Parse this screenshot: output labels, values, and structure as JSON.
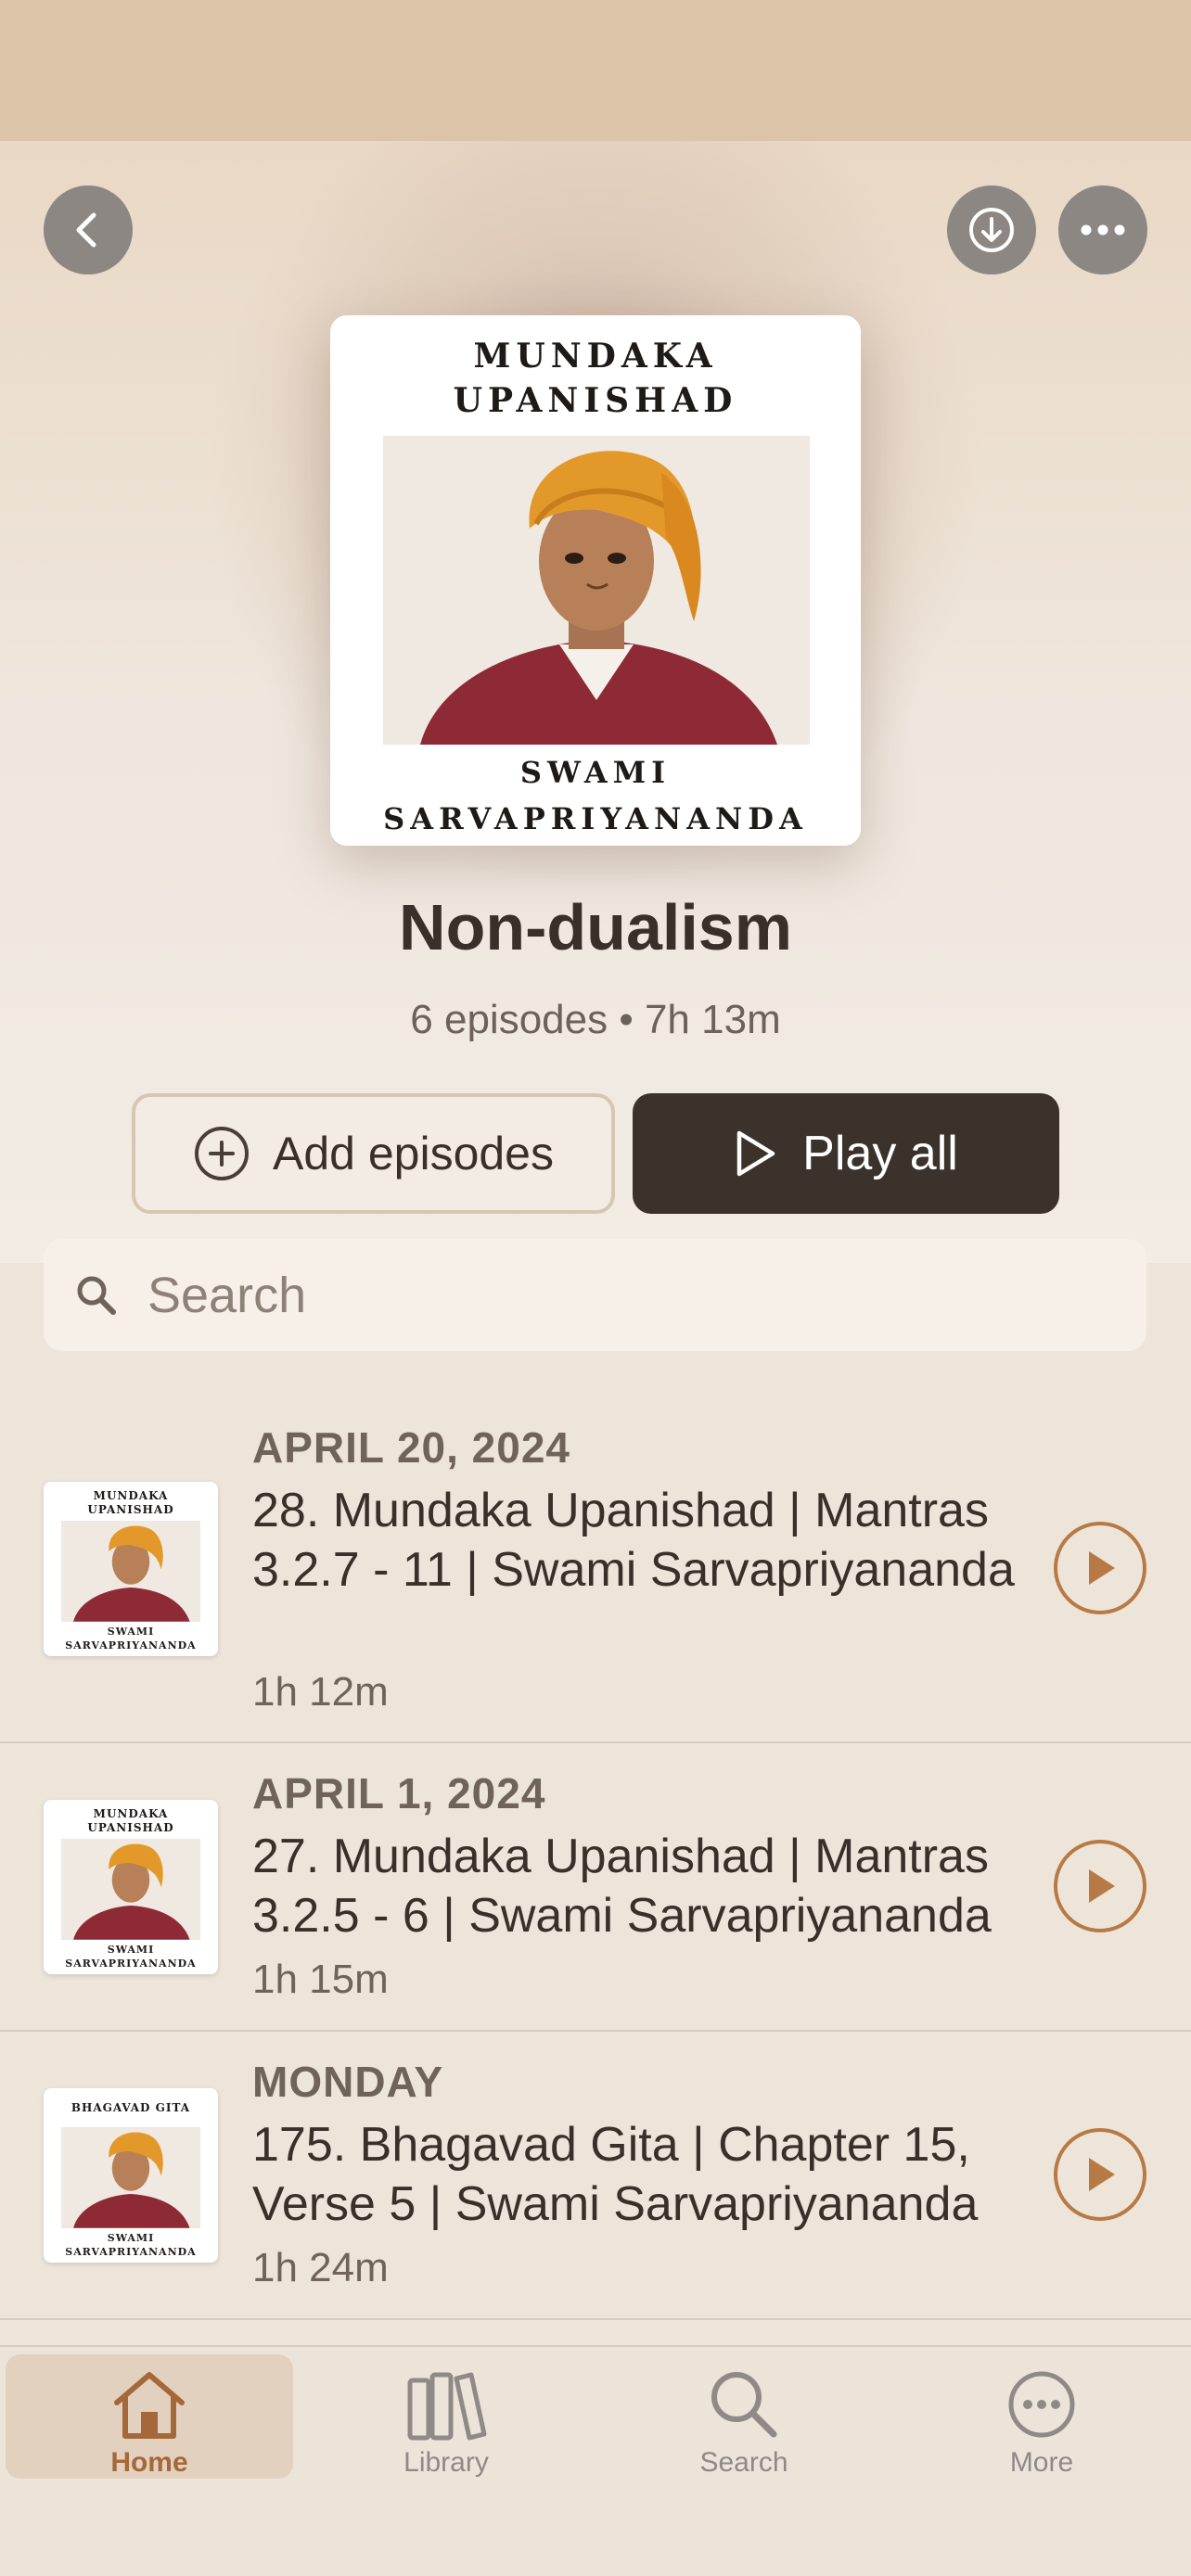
{
  "header": {
    "back_icon": "chevron-left-icon",
    "download_icon": "download-circle-icon",
    "more_icon": "ellipsis-icon"
  },
  "artwork": {
    "title_line1": "MUNDAKA",
    "title_line2": "UPANISHAD",
    "author_line1": "SWAMI",
    "author_line2": "SARVAPRIYANANDA"
  },
  "playlist": {
    "title": "Non-dualism",
    "meta": "6 episodes • 7h 13m"
  },
  "actions": {
    "add_label": "Add episodes",
    "play_all_label": "Play all"
  },
  "search": {
    "placeholder": "Search"
  },
  "episodes": [
    {
      "date": "APRIL 20, 2024",
      "title": "28. Mundaka Upanishad | Mantras 3.2.7 - 11 | Swami Sarvapriyananda",
      "duration": "1h 12m",
      "thumb_title_line1": "MUNDAKA",
      "thumb_title_line2": "UPANISHAD",
      "thumb_author_line1": "SWAMI",
      "thumb_author_line2": "SARVAPRIYANANDA"
    },
    {
      "date": "APRIL 1, 2024",
      "title": "27. Mundaka Upanishad | Mantras 3.2.5 - 6 | Swami Sarvapriyananda",
      "duration": "1h 15m",
      "thumb_title_line1": "MUNDAKA",
      "thumb_title_line2": "UPANISHAD",
      "thumb_author_line1": "SWAMI",
      "thumb_author_line2": "SARVAPRIYANANDA"
    },
    {
      "date": "MONDAY",
      "title": "175. Bhagavad Gita | Chapter 15, Verse 5 | Swami Sarvapriyananda",
      "duration": "1h 24m",
      "thumb_title_line1": "BHAGAVAD GITA",
      "thumb_author_line1": "SWAMI",
      "thumb_author_line2": "SARVAPRIYANANDA"
    }
  ],
  "tabs": [
    {
      "label": "Home",
      "icon": "home-icon",
      "active": true
    },
    {
      "label": "Library",
      "icon": "library-icon",
      "active": false
    },
    {
      "label": "Search",
      "icon": "search-icon",
      "active": false
    },
    {
      "label": "More",
      "icon": "more-circle-icon",
      "active": false
    }
  ],
  "colors": {
    "accent": "#b87a45",
    "dark_button": "#3b322b",
    "background": "#ede4da"
  }
}
